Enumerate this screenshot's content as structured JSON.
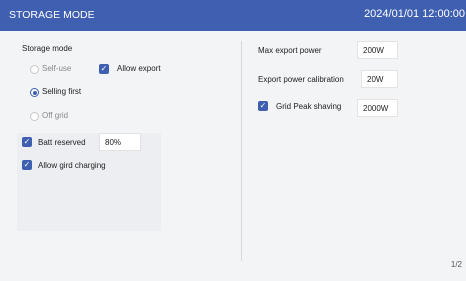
{
  "header": {
    "title": "STORAGE MODE",
    "datetime": "2024/01/01 12:00:00"
  },
  "storage_mode": {
    "label": "Storage mode",
    "options": [
      "Self-use",
      "Selling first",
      "Off grid"
    ],
    "selected": "Selling first",
    "allow_export": {
      "label": "Allow export",
      "checked": true
    }
  },
  "battery": {
    "batt_reserved": {
      "label": "Batt reserved",
      "checked": true,
      "value": "80%"
    },
    "allow_grid_charging": {
      "label": "Allow gird charging",
      "checked": true
    }
  },
  "export": {
    "max_export_power": {
      "label": "Max export power",
      "value": "200W"
    },
    "export_power_calibration": {
      "label": "Export power calibration",
      "value": "20W"
    },
    "grid_peak_shaving": {
      "label": "Grid Peak shaving",
      "checked": true,
      "value": "2000W"
    }
  },
  "pager": "1/2",
  "colors": {
    "accent": "#3f5fb0",
    "header_bg": "#3f5fb0",
    "panel_bg": "#eceef2"
  }
}
